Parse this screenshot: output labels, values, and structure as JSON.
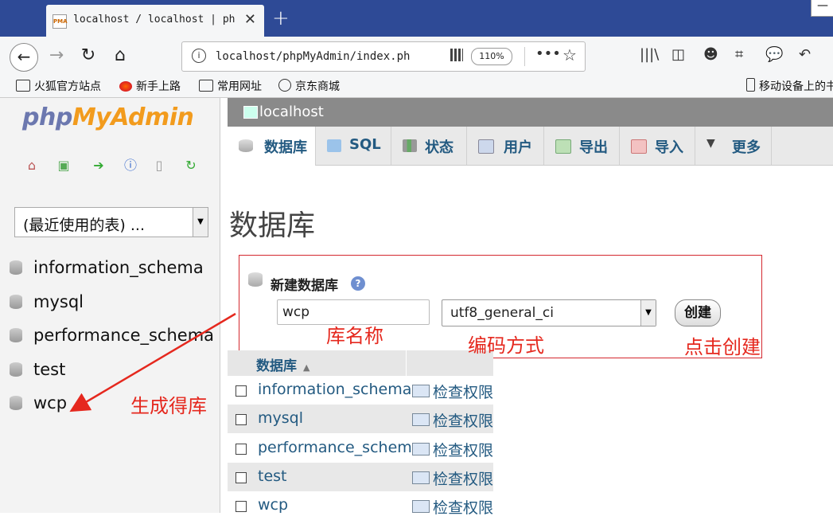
{
  "browser": {
    "tab_title": "localhost / localhost | ph",
    "favicon_text": "PMA",
    "new_tab": "+",
    "url": "localhost/phpMyAdmin/index.ph",
    "zoom": "110%",
    "bookmarks": [
      "火狐官方站点",
      "新手上路",
      "常用网址",
      "京东商城"
    ],
    "mobile_bookmarks": "移动设备上的书"
  },
  "nav": {
    "logo_php": "php",
    "logo_myadmin": "MyAdmin",
    "recent_tables": "(最近使用的表) ...",
    "databases": [
      "information_schema",
      "mysql",
      "performance_schema",
      "test",
      "wcp"
    ]
  },
  "main": {
    "server": "localhost",
    "tabs": [
      "数据库",
      "SQL",
      "状态",
      "用户",
      "导出",
      "导入",
      "更多"
    ],
    "page_title": "数据库",
    "create": {
      "title": "新建数据库",
      "db_name": "wcp",
      "collation": "utf8_general_ci",
      "button": "创建"
    },
    "table": {
      "header": "数据库",
      "privileges_label": "检查权限",
      "rows": [
        "information_schema",
        "mysql",
        "performance_schema",
        "test",
        "wcp"
      ]
    }
  },
  "annotations": {
    "name_label": "库名称",
    "encoding_label": "编码方式",
    "click_label": "点击创建",
    "generated_label": "生成得库"
  }
}
